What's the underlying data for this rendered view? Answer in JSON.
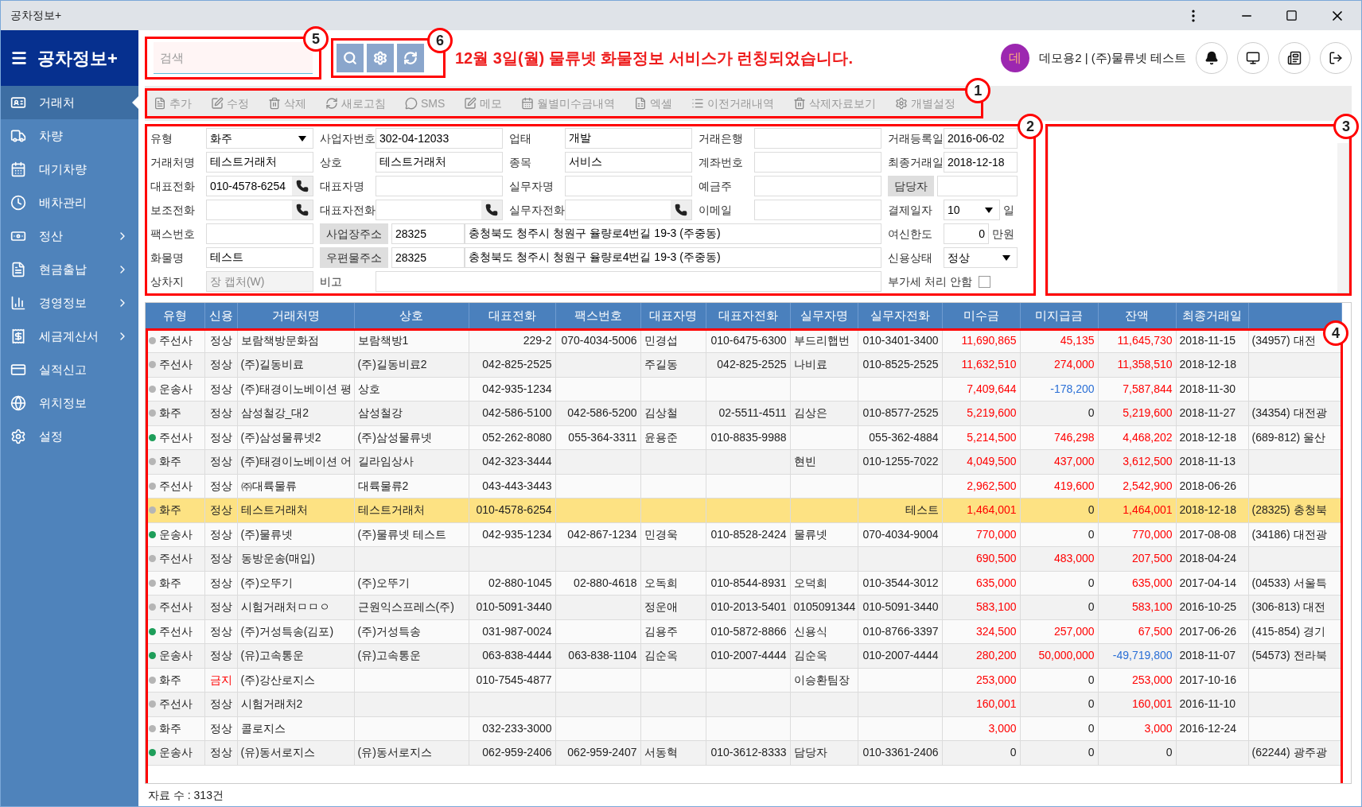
{
  "window": {
    "title": "공차정보+"
  },
  "sidebar": {
    "title": "공차정보+",
    "items": [
      {
        "label": "거래처",
        "selected": true,
        "has_submenu": false
      },
      {
        "label": "차량",
        "selected": false,
        "has_submenu": false
      },
      {
        "label": "대기차량",
        "selected": false,
        "has_submenu": false
      },
      {
        "label": "배차관리",
        "selected": false,
        "has_submenu": false
      },
      {
        "label": "정산",
        "selected": false,
        "has_submenu": true
      },
      {
        "label": "현금출납",
        "selected": false,
        "has_submenu": true
      },
      {
        "label": "경영정보",
        "selected": false,
        "has_submenu": true
      },
      {
        "label": "세금계산서",
        "selected": false,
        "has_submenu": true
      },
      {
        "label": "실적신고",
        "selected": false,
        "has_submenu": false
      },
      {
        "label": "위치정보",
        "selected": false,
        "has_submenu": false
      },
      {
        "label": "설정",
        "selected": false,
        "has_submenu": false
      }
    ]
  },
  "search": {
    "placeholder": "검색",
    "callout": "5"
  },
  "search_buttons": {
    "callout": "6"
  },
  "notice": "12월 3일(월) 물류넷 화물정보 서비스가 런칭되었습니다.",
  "user": {
    "avatar": "데",
    "name": "데모용2 | (주)물류넷 테스트"
  },
  "toolbar": {
    "callout": "1",
    "items": [
      "추가",
      "수정",
      "삭제",
      "새로고침",
      "SMS",
      "메모",
      "월별미수금내역",
      "엑셀",
      "이전거래내역",
      "삭제자료보기",
      "개별설정"
    ]
  },
  "form": {
    "callout": "2",
    "rows": [
      {
        "groups": [
          {
            "label": "유형",
            "controls": [
              {
                "kind": "select",
                "value": "화주"
              }
            ]
          },
          {
            "label": "사업자번호",
            "controls": [
              {
                "kind": "text",
                "value": "302-04-12033"
              }
            ]
          },
          {
            "label": "업태",
            "controls": [
              {
                "kind": "text",
                "value": "개발"
              }
            ]
          },
          {
            "label": "거래은행",
            "controls": [
              {
                "kind": "text"
              }
            ]
          },
          {
            "label": "거래등록일",
            "controls": [
              {
                "kind": "text",
                "value": "2016-06-02"
              }
            ]
          }
        ]
      },
      {
        "groups": [
          {
            "label": "거래처명",
            "controls": [
              {
                "kind": "text",
                "value": "테스트거래처"
              }
            ]
          },
          {
            "label": "상호",
            "controls": [
              {
                "kind": "text",
                "value": "테스트거래처"
              }
            ]
          },
          {
            "label": "종목",
            "controls": [
              {
                "kind": "text",
                "value": "서비스"
              }
            ]
          },
          {
            "label": "계좌번호",
            "controls": [
              {
                "kind": "text"
              }
            ]
          },
          {
            "label": "최종거래일",
            "controls": [
              {
                "kind": "text",
                "value": "2018-12-18"
              }
            ]
          }
        ]
      },
      {
        "groups": [
          {
            "label": "대표전화",
            "controls": [
              {
                "kind": "phone",
                "value": "010-4578-6254"
              }
            ]
          },
          {
            "label": "대표자명",
            "controls": [
              {
                "kind": "text"
              }
            ]
          },
          {
            "label": "실무자명",
            "controls": [
              {
                "kind": "text"
              }
            ]
          },
          {
            "label": "예금주",
            "controls": [
              {
                "kind": "text"
              }
            ]
          },
          {
            "label": "담당자",
            "label_button": true,
            "controls": [
              {
                "kind": "text"
              }
            ]
          }
        ]
      },
      {
        "groups": [
          {
            "label": "보조전화",
            "controls": [
              {
                "kind": "phone"
              }
            ]
          },
          {
            "label": "대표자전화",
            "controls": [
              {
                "kind": "phone"
              }
            ]
          },
          {
            "label": "실무자전화",
            "controls": [
              {
                "kind": "phone"
              }
            ]
          },
          {
            "label": "이메일",
            "controls": [
              {
                "kind": "text"
              }
            ]
          },
          {
            "label": "결제일자",
            "controls": [
              {
                "kind": "select",
                "value": "10"
              },
              {
                "kind": "unit",
                "text": "일"
              }
            ]
          }
        ]
      },
      {
        "groups": [
          {
            "label": "팩스번호",
            "controls": [
              {
                "kind": "text"
              }
            ]
          },
          {
            "label": "사업장주소",
            "label_button": true,
            "controls": [
              {
                "kind": "zip",
                "value": "28325"
              },
              {
                "kind": "wide",
                "value": "충청북도 청주시 청원구 율량로4번길 19-3 (주중동)"
              }
            ]
          },
          {
            "label": "여신한도",
            "controls": [
              {
                "kind": "number",
                "value": "0"
              },
              {
                "kind": "unit",
                "text": "만원"
              }
            ]
          }
        ]
      },
      {
        "groups": [
          {
            "label": "화물명",
            "controls": [
              {
                "kind": "text",
                "value": "테스트"
              }
            ]
          },
          {
            "label": "우편물주소",
            "label_button": true,
            "controls": [
              {
                "kind": "zip",
                "value": "28325"
              },
              {
                "kind": "wide",
                "value": "충청북도 청주시 청원구 율량로4번길 19-3 (주중동)"
              }
            ]
          },
          {
            "label": "신용상태",
            "controls": [
              {
                "kind": "select",
                "value": "정상"
              }
            ]
          }
        ]
      },
      {
        "groups": [
          {
            "label": "상차지",
            "controls": [
              {
                "kind": "text",
                "placeholder": "장 캡처(W)",
                "disabled": true
              }
            ]
          },
          {
            "label": "비고",
            "controls": [
              {
                "kind": "wide"
              }
            ]
          },
          {
            "label": "부가세 처리 안함",
            "controls": [
              {
                "kind": "checkbox",
                "checked": false
              }
            ]
          }
        ]
      }
    ]
  },
  "memo": {
    "callout": "3"
  },
  "table": {
    "callout": "4",
    "columns": [
      "유형",
      "신용",
      "거래처명",
      "상호",
      "대표전화",
      "팩스번호",
      "대표자명",
      "대표자전화",
      "실무자명",
      "실무자전화",
      "미수금",
      "미지급금",
      "잔액",
      "최종거래일"
    ],
    "rows": [
      {
        "color": "#b5b5b5",
        "blocked": false,
        "selected": false,
        "cells": [
          "주선사",
          "정상",
          "보람책방문화점",
          "보람책방1",
          "229-2",
          "070-4034-5006",
          "민경섭",
          "010-6475-6300",
          "부드리햅번",
          "010-3401-3400",
          {
            "text": "11,690,865",
            "color": "#ff0000"
          },
          {
            "text": "45,135",
            "color": "#ff0000"
          },
          {
            "text": "11,645,730",
            "color": "#ff0000"
          },
          "2018-11-15",
          "(34957) 대전"
        ]
      },
      {
        "color": "#b5b5b5",
        "blocked": false,
        "selected": false,
        "cells": [
          "주선사",
          "정상",
          "(주)길동비료",
          "(주)길동비료2",
          "042-825-2525",
          "",
          "주길동",
          "042-825-2525",
          "나비료",
          "010-8525-2525",
          {
            "text": "11,632,510",
            "color": "#ff0000"
          },
          {
            "text": "274,000",
            "color": "#ff0000"
          },
          {
            "text": "11,358,510",
            "color": "#ff0000"
          },
          "2018-12-18",
          ""
        ]
      },
      {
        "color": "#b5b5b5",
        "blocked": false,
        "selected": false,
        "cells": [
          "운송사",
          "정상",
          "(주)태경이노베이션 평",
          "상호",
          "042-935-1234",
          "",
          "",
          "",
          "",
          "",
          {
            "text": "7,409,644",
            "color": "#ff0000"
          },
          {
            "text": "-178,200",
            "color": "#2a6fd6"
          },
          {
            "text": "7,587,844",
            "color": "#ff0000"
          },
          "2018-11-30",
          ""
        ]
      },
      {
        "color": "#b5b5b5",
        "blocked": false,
        "selected": false,
        "cells": [
          "화주",
          "정상",
          "삼성철강_대2",
          "삼성철강",
          "042-586-5100",
          "042-586-5200",
          "김상철",
          "02-5511-4511",
          "김상은",
          "010-8577-2525",
          {
            "text": "5,219,600",
            "color": "#ff0000"
          },
          {
            "text": "0",
            "color": "#222222"
          },
          {
            "text": "5,219,600",
            "color": "#ff0000"
          },
          "2018-11-27",
          "(34354) 대전광"
        ]
      },
      {
        "color": "#1e9e5a",
        "blocked": false,
        "selected": false,
        "cells": [
          "주선사",
          "정상",
          "(주)삼성물류넷2",
          "(주)삼성물류넷",
          "052-262-8080",
          "055-364-3311",
          "윤용준",
          "010-8835-9988",
          "",
          "055-362-4884",
          {
            "text": "5,214,500",
            "color": "#ff0000"
          },
          {
            "text": "746,298",
            "color": "#ff0000"
          },
          {
            "text": "4,468,202",
            "color": "#ff0000"
          },
          "2018-12-18",
          "(689-812) 울산"
        ]
      },
      {
        "color": "#b5b5b5",
        "blocked": false,
        "selected": false,
        "cells": [
          "화주",
          "정상",
          "(주)태경이노베이션 어",
          "길라임상사",
          "042-323-3444",
          "",
          "",
          "",
          "현빈",
          "010-1255-7022",
          {
            "text": "4,049,500",
            "color": "#ff0000"
          },
          {
            "text": "437,000",
            "color": "#ff0000"
          },
          {
            "text": "3,612,500",
            "color": "#ff0000"
          },
          "2018-11-13",
          ""
        ]
      },
      {
        "color": "#b5b5b5",
        "blocked": false,
        "selected": false,
        "cells": [
          "주선사",
          "정상",
          "㈜대륙물류",
          "대륙물류2",
          "043-443-3443",
          "",
          "",
          "",
          "",
          "",
          {
            "text": "2,962,500",
            "color": "#ff0000"
          },
          {
            "text": "419,600",
            "color": "#ff0000"
          },
          {
            "text": "2,542,900",
            "color": "#ff0000"
          },
          "2018-06-26",
          ""
        ]
      },
      {
        "color": "#b5b5b5",
        "blocked": false,
        "selected": true,
        "cells": [
          "화주",
          "정상",
          "테스트거래처",
          "테스트거래처",
          "010-4578-6254",
          "",
          "",
          "",
          "",
          "테스트",
          {
            "text": "1,464,001",
            "color": "#ff0000"
          },
          {
            "text": "0",
            "color": "#222222"
          },
          {
            "text": "1,464,001",
            "color": "#ff0000"
          },
          "2018-12-18",
          "(28325) 충청북"
        ]
      },
      {
        "color": "#1e9e5a",
        "blocked": false,
        "selected": false,
        "cells": [
          "운송사",
          "정상",
          "(주)물류넷",
          "(주)물류넷 테스트",
          "042-935-1234",
          "042-867-1234",
          "민경욱",
          "010-8528-2424",
          "물류넷",
          "070-4034-9004",
          {
            "text": "770,000",
            "color": "#ff0000"
          },
          {
            "text": "0",
            "color": "#222222"
          },
          {
            "text": "770,000",
            "color": "#ff0000"
          },
          "2017-08-08",
          "(34186) 대전광"
        ]
      },
      {
        "color": "#b5b5b5",
        "blocked": false,
        "selected": false,
        "cells": [
          "주선사",
          "정상",
          "동방운송(매입)",
          "",
          "",
          "",
          "",
          "",
          "",
          "",
          {
            "text": "690,500",
            "color": "#ff0000"
          },
          {
            "text": "483,000",
            "color": "#ff0000"
          },
          {
            "text": "207,500",
            "color": "#ff0000"
          },
          "2018-04-24",
          ""
        ]
      },
      {
        "color": "#b5b5b5",
        "blocked": false,
        "selected": false,
        "cells": [
          "화주",
          "정상",
          "(주)오뚜기",
          "(주)오뚜기",
          "02-880-1045",
          "02-880-4618",
          "오독희",
          "010-8544-8931",
          "오덕희",
          "010-3544-3012",
          {
            "text": "635,000",
            "color": "#ff0000"
          },
          {
            "text": "0",
            "color": "#222222"
          },
          {
            "text": "635,000",
            "color": "#ff0000"
          },
          "2017-04-14",
          "(04533) 서울특"
        ]
      },
      {
        "color": "#b5b5b5",
        "blocked": false,
        "selected": false,
        "cells": [
          "주선사",
          "정상",
          "시험거래처ㅁㅁㅇ",
          "근원익스프레스(주)",
          "010-5091-3440",
          "",
          "정운애",
          "010-2013-5401",
          "0105091344",
          "010-5091-3440",
          {
            "text": "583,100",
            "color": "#ff0000"
          },
          {
            "text": "0",
            "color": "#222222"
          },
          {
            "text": "583,100",
            "color": "#ff0000"
          },
          "2016-10-25",
          "(306-813) 대전"
        ]
      },
      {
        "color": "#1e9e5a",
        "blocked": false,
        "selected": false,
        "cells": [
          "주선사",
          "정상",
          "(주)거성특송(김포)",
          "(주)거성특송",
          "031-987-0024",
          "",
          "김용주",
          "010-5872-8866",
          "신용식",
          "010-8766-3397",
          {
            "text": "324,500",
            "color": "#ff0000"
          },
          {
            "text": "257,000",
            "color": "#ff0000"
          },
          {
            "text": "67,500",
            "color": "#ff0000"
          },
          "2017-06-26",
          "(415-854) 경기"
        ]
      },
      {
        "color": "#1e9e5a",
        "blocked": false,
        "selected": false,
        "cells": [
          "운송사",
          "정상",
          "(유)고속통운",
          "(유)고속통운",
          "063-838-4444",
          "063-838-1104",
          "김순옥",
          "010-2007-4444",
          "김순옥",
          "010-2007-4444",
          {
            "text": "280,200",
            "color": "#ff0000"
          },
          {
            "text": "50,000,000",
            "color": "#ff0000"
          },
          {
            "text": "-49,719,800",
            "color": "#2a6fd6"
          },
          "2018-11-07",
          "(54573) 전라북"
        ]
      },
      {
        "color": "#b5b5b5",
        "blocked": true,
        "selected": false,
        "cells": [
          "화주",
          "금지",
          "(주)강산로지스",
          "",
          "010-7545-4877",
          "",
          "",
          "",
          "이승환팀장",
          "",
          {
            "text": "253,000",
            "color": "#ff0000"
          },
          {
            "text": "0",
            "color": "#222222"
          },
          {
            "text": "253,000",
            "color": "#ff0000"
          },
          "2017-10-16",
          ""
        ]
      },
      {
        "color": "#b5b5b5",
        "blocked": false,
        "selected": false,
        "cells": [
          "주선사",
          "정상",
          "시험거래처2",
          "",
          "",
          "",
          "",
          "",
          "",
          "",
          {
            "text": "160,001",
            "color": "#ff0000"
          },
          {
            "text": "0",
            "color": "#222222"
          },
          {
            "text": "160,001",
            "color": "#ff0000"
          },
          "2016-11-10",
          ""
        ]
      },
      {
        "color": "#b5b5b5",
        "blocked": false,
        "selected": false,
        "cells": [
          "화주",
          "정상",
          "콜로지스",
          "",
          "032-233-3000",
          "",
          "",
          "",
          "",
          "",
          {
            "text": "3,000",
            "color": "#ff0000"
          },
          {
            "text": "0",
            "color": "#222222"
          },
          {
            "text": "3,000",
            "color": "#ff0000"
          },
          "2016-12-24",
          ""
        ]
      },
      {
        "color": "#1e9e5a",
        "blocked": false,
        "selected": false,
        "cells": [
          "운송사",
          "정상",
          "(유)동서로지스",
          "(유)동서로지스",
          "062-959-2406",
          "062-959-2407",
          "서동혁",
          "010-3612-8333",
          "담당자",
          "010-3361-2406",
          {
            "text": "0",
            "color": "#222222"
          },
          {
            "text": "0",
            "color": "#222222"
          },
          {
            "text": "0",
            "color": "#222222"
          },
          "",
          "(62244) 광주광"
        ]
      }
    ]
  },
  "status_bar": "자료 수 : 313건"
}
